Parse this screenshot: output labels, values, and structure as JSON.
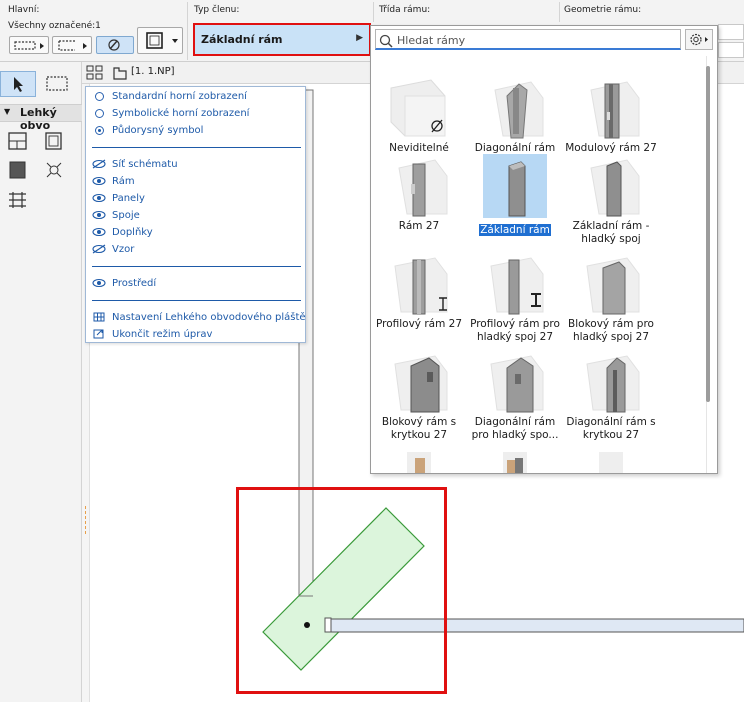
{
  "info_box": {
    "main_label": "Hlavní:",
    "selected_label": "Všechny označené:1",
    "member_type_label": "Typ členu:",
    "frame_class_label": "Třída rámu:",
    "frame_geometry_label": "Geometrie rámu:",
    "frame_type_value": "Základní rám"
  },
  "toolbox": {
    "section_title": "Lehký obvo"
  },
  "view": {
    "floor_label": "[1. 1.NP]"
  },
  "display_menu": {
    "items": [
      {
        "label": "Standardní horní zobrazení",
        "icon": "radio-off-icon"
      },
      {
        "label": "Symbolické horní zobrazení",
        "icon": "radio-off-icon"
      },
      {
        "label": "Půdorysný symbol",
        "icon": "radio-on-icon"
      },
      {
        "label": "Síť schématu",
        "icon": "eye-hidden-icon"
      },
      {
        "label": "Rám",
        "icon": "eye-icon"
      },
      {
        "label": "Panely",
        "icon": "eye-icon"
      },
      {
        "label": "Spoje",
        "icon": "eye-icon"
      },
      {
        "label": "Doplňky",
        "icon": "eye-icon"
      },
      {
        "label": "Vzor",
        "icon": "eye-hidden-icon"
      },
      {
        "label": "Prostředí",
        "icon": "eye-icon"
      },
      {
        "label": "Nastavení Lehkého obvodového pláště",
        "icon": "grid-settings-icon"
      },
      {
        "label": "Ukončit režim úprav",
        "icon": "exit-icon"
      }
    ]
  },
  "frame_picker": {
    "search_placeholder": "Hledat rámy",
    "items": [
      {
        "name": "Neviditelné",
        "line1": "Neviditelné",
        "line2": "",
        "selected": false
      },
      {
        "name": "Diagonální rám 27",
        "line1": "Diagonální rám",
        "line2": "27",
        "selected": false
      },
      {
        "name": "Modulový rám 27",
        "line1": "Modulový rám 27",
        "line2": "",
        "selected": false
      },
      {
        "name": "Rám 27",
        "line1": "Rám 27",
        "line2": "",
        "selected": false
      },
      {
        "name": "Základní rám",
        "line1": "Základní rám",
        "line2": "",
        "selected": true
      },
      {
        "name": "Základní rám - hladký spoj",
        "line1": "Základní rám -",
        "line2": "hladký spoj",
        "selected": false
      },
      {
        "name": "Profilový rám 27",
        "line1": "Profilový rám 27",
        "line2": "",
        "selected": false
      },
      {
        "name": "Profilový rám pro hladký spoj 27",
        "line1": "Profilový rám pro",
        "line2": "hladký spoj 27",
        "selected": false
      },
      {
        "name": "Blokový rám pro hladký spoj 27",
        "line1": "Blokový rám pro",
        "line2": "hladký spoj 27",
        "selected": false
      },
      {
        "name": "Blokový rám s krytkou 27",
        "line1": "Blokový rám s",
        "line2": "krytkou 27",
        "selected": false
      },
      {
        "name": "Diagonální rám pro hladký spo...",
        "line1": "Diagonální rám",
        "line2": "pro hladký spo...",
        "selected": false
      },
      {
        "name": "Diagonální rám s krytkou 27",
        "line1": "Diagonální rám s",
        "line2": "krytkou 27",
        "selected": false
      }
    ]
  },
  "colors": {
    "highlight_red": "#e01010",
    "selection_blue": "#1f6fd1",
    "menu_text_blue": "#1e5aa8",
    "frame_green": "#3a9a3a"
  }
}
